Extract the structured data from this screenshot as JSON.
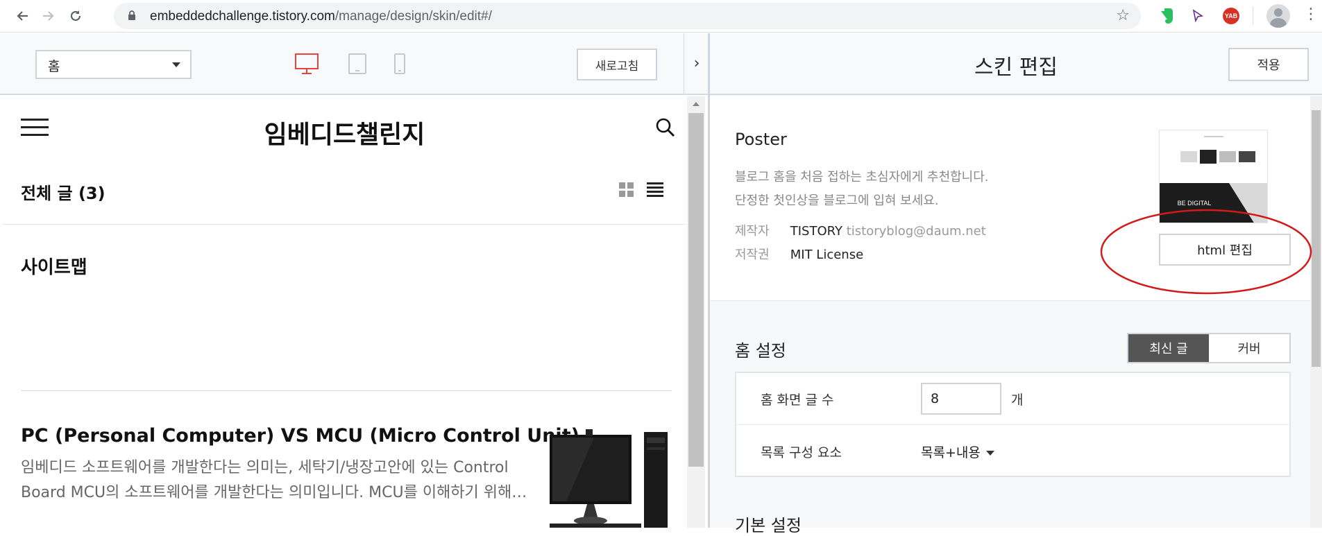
{
  "browser": {
    "url_host": "embeddedchallenge.tistory.com",
    "url_path": "/manage/design/skin/edit#/",
    "ext_yab_label": "YAB"
  },
  "left_toolbar": {
    "page_select_value": "홈",
    "refresh_label": "새로고침",
    "collapse_label": "›"
  },
  "preview": {
    "blog_title": "임베디드챌린지",
    "all_posts_label": "전체 글 (3)",
    "sitemap_label": "사이트맵",
    "post": {
      "title": "PC (Personal Computer) VS MCU (Micro Control Unit)",
      "excerpt": "임베디드 소프트웨어를 개발한다는 의미는, 세탁기/냉장고안에 있는 Control Board MCU의 소프트웨어를 개발한다는 의미입니다. MCU를 이해하기 위해…"
    }
  },
  "editor": {
    "title": "스킨 편집",
    "apply_label": "적용",
    "skin": {
      "name": "Poster",
      "desc_line1": "블로그 홈을 처음 접하는 초심자에게 추천합니다.",
      "desc_line2": "단정한 첫인상을 블로그에 입혀 보세요.",
      "author_key": "제작자",
      "author_name": "TISTORY",
      "author_email": "tistoryblog@daum.net",
      "license_key": "저작권",
      "license_value": "MIT License",
      "thumb_caption": "BE DIGITAL",
      "html_edit_label": "html 편집"
    },
    "home_settings": {
      "title": "홈 설정",
      "tab_recent": "최신 글",
      "tab_cover": "커버",
      "post_count_label": "홈 화면 글 수",
      "post_count_value": "8",
      "post_count_unit": "개",
      "list_label": "목록 구성 요소",
      "list_value": "목록+내용"
    },
    "basic_settings_title": "기본 설정"
  },
  "colors": {
    "accent_red": "#e8423a",
    "annotation_red": "#d11a1a",
    "tab_active": "#555555"
  }
}
